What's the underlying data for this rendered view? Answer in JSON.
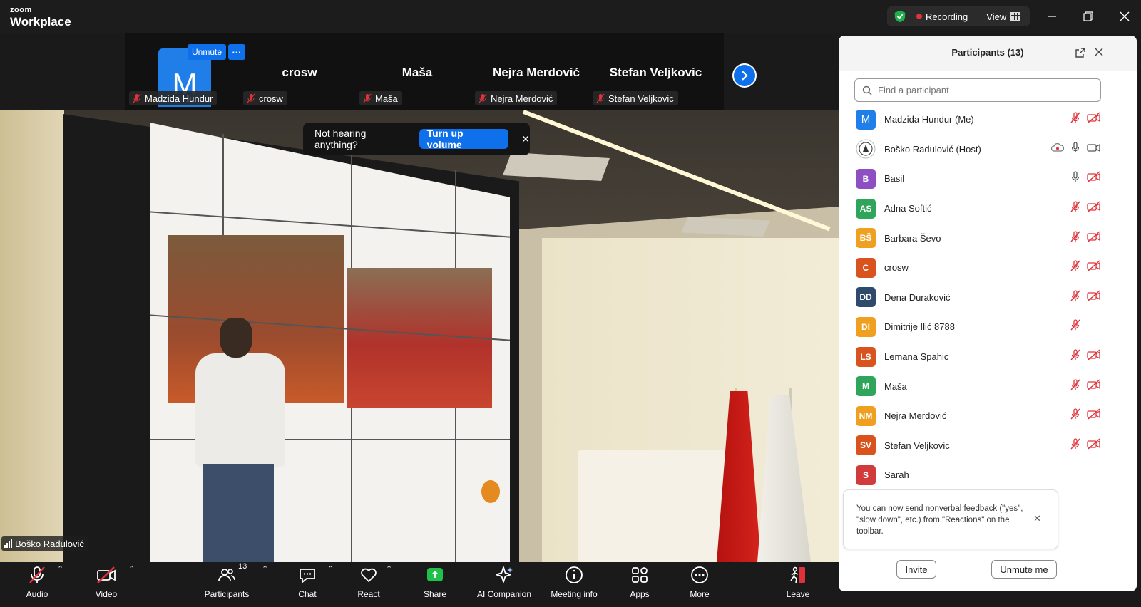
{
  "app": {
    "brand_small": "zoom",
    "brand_large": "Workplace"
  },
  "titlebar": {
    "recording_label": "Recording",
    "view_label": "View"
  },
  "gallery": {
    "self": {
      "avatar_letter": "M",
      "unmute_label": "Unmute",
      "more_label": "···",
      "name": "Madzida Hundur"
    },
    "tiles": [
      {
        "name": "crosw",
        "tag": "crosw"
      },
      {
        "name": "Maša",
        "tag": "Maša"
      },
      {
        "name": "Nejra Merdović",
        "tag": "Nejra Merdović"
      },
      {
        "name": "Stefan Veljkovic",
        "tag": "Stefan Veljkovic"
      }
    ]
  },
  "toast": {
    "text": "Not hearing anything?",
    "button": "Turn up volume"
  },
  "video": {
    "speaker_name": "Boško Radulović"
  },
  "toolbar": {
    "audio": "Audio",
    "video": "Video",
    "participants": "Participants",
    "participants_count": "13",
    "chat": "Chat",
    "react": "React",
    "share": "Share",
    "ai": "AI Companion",
    "info": "Meeting info",
    "apps": "Apps",
    "more": "More",
    "leave": "Leave"
  },
  "panel": {
    "title": "Participants (13)",
    "search_placeholder": "Find a participant",
    "participants": [
      {
        "initials": "M",
        "name": "Madzida Hundur (Me)",
        "color": "#1f7ee8",
        "mic": "muted",
        "video": "off",
        "big": true
      },
      {
        "initials": "",
        "name": "Boško Radulović (Host)",
        "color": "#ffffff",
        "mic": "on",
        "video": "on",
        "logo": true,
        "cloud": true
      },
      {
        "initials": "B",
        "name": "Basil",
        "color": "#8e4fc3",
        "mic": "on",
        "video": "off"
      },
      {
        "initials": "AS",
        "name": "Adna Softić",
        "color": "#2ea55a",
        "mic": "muted",
        "video": "off"
      },
      {
        "initials": "BŠ",
        "name": "Barbara Ševo",
        "color": "#f0a020",
        "mic": "muted",
        "video": "off"
      },
      {
        "initials": "C",
        "name": "crosw",
        "color": "#d9531e",
        "mic": "muted",
        "video": "off"
      },
      {
        "initials": "DD",
        "name": "Dena Duraković",
        "color": "#2f4a6b",
        "mic": "muted",
        "video": "off"
      },
      {
        "initials": "DI",
        "name": "Dimitrije Ilić 8788",
        "color": "#f0a020",
        "mic": "muted",
        "video": "none"
      },
      {
        "initials": "LS",
        "name": "Lemana Spahic",
        "color": "#d9531e",
        "mic": "muted",
        "video": "off"
      },
      {
        "initials": "M",
        "name": "Maša",
        "color": "#2ea55a",
        "mic": "muted",
        "video": "off"
      },
      {
        "initials": "NM",
        "name": "Nejra Merdović",
        "color": "#f0a020",
        "mic": "muted",
        "video": "off"
      },
      {
        "initials": "SV",
        "name": "Stefan Veljkovic",
        "color": "#d9531e",
        "mic": "muted",
        "video": "off"
      },
      {
        "initials": "S",
        "name": "Sarah",
        "color": "#d13b3b",
        "mic": "none",
        "video": "none"
      }
    ],
    "feedback_text": "You can now send nonverbal feedback (\"yes\", \"slow down\", etc.) from \"Reactions\" on the toolbar.",
    "invite_label": "Invite",
    "unmute_me_label": "Unmute me"
  }
}
